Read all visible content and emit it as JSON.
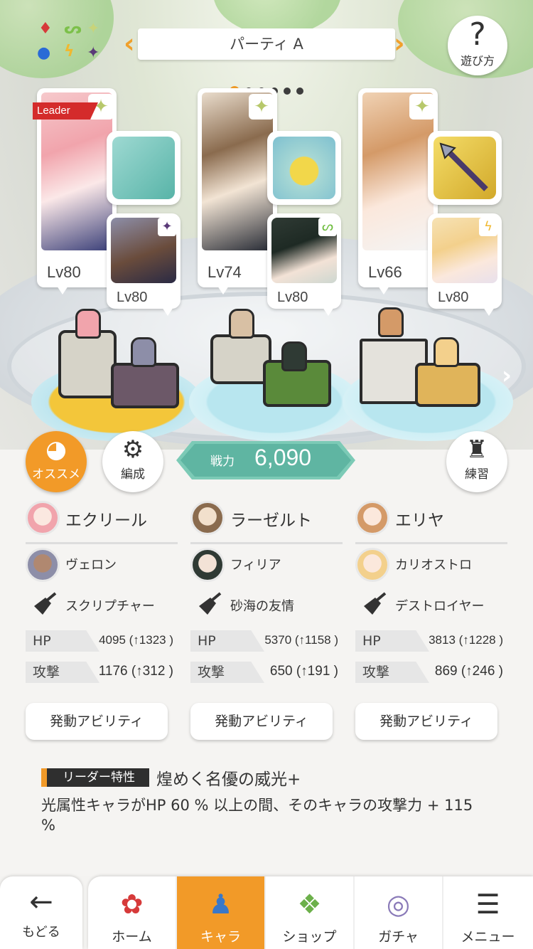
{
  "party": {
    "title": "パーティ A",
    "page_count": 6,
    "current_page": 1,
    "help_label": "遊び方"
  },
  "leader_badge": "Leader",
  "slots": [
    {
      "main": {
        "name": "エクリール",
        "level": "Lv80",
        "element": "light",
        "hair": "#f1a4ac"
      },
      "equipment": {
        "name": "スクリプチャー",
        "icon": "book-icon",
        "bg": "#7cc6c2"
      },
      "sub": {
        "name": "ヴェロン",
        "level": "Lv80",
        "element": "dark",
        "element_icon": "✦"
      },
      "stats": {
        "hp_label": "HP",
        "hp": "4095 (↑1323 )",
        "atk_label": "攻撃",
        "atk": "1176 (↑312 )"
      },
      "ability_label": "発動アビリティ",
      "pedestal_color": "#f3c63a",
      "block_color": "#6c5868"
    },
    {
      "main": {
        "name": "ラーゼルト",
        "level": "Lv74",
        "element": "light",
        "hair": "#8a6b4e"
      },
      "equipment": {
        "name": "砂海の友情",
        "icon": "coin-icon",
        "bg": "#a8d8d4"
      },
      "sub": {
        "name": "フィリア",
        "level": "Lv80",
        "element": "wind",
        "element_icon": "ᔕ"
      },
      "stats": {
        "hp_label": "HP",
        "hp": "5370 (↑1158 )",
        "atk_label": "攻撃",
        "atk": "650 (↑191 )"
      },
      "ability_label": "発動アビリティ",
      "pedestal_color": "#b8e6ef",
      "block_color": "#5a8a3a"
    },
    {
      "main": {
        "name": "エリヤ",
        "level": "Lv66",
        "element": "light",
        "hair": "#d49a68"
      },
      "equipment": {
        "name": "デストロイヤー",
        "icon": "spear-icon",
        "bg": "#e6c640"
      },
      "sub": {
        "name": "カリオストロ",
        "level": "Lv80",
        "element": "thunder",
        "element_icon": "ϟ"
      },
      "stats": {
        "hp_label": "HP",
        "hp": "3813 (↑1228 )",
        "atk_label": "攻撃",
        "atk": "869 (↑246 )"
      },
      "ability_label": "発動アビリティ",
      "pedestal_color": "#b8e6ef",
      "block_color": "#e0b45a"
    }
  ],
  "buttons": {
    "recommend": "オススメ",
    "edit": "編成",
    "practice": "練習"
  },
  "power": {
    "label": "戦力",
    "value": "6,090"
  },
  "leader_trait": {
    "tag": "リーダー特性",
    "name": "煌めく名優の威光+",
    "description": "光属性キャラがHP 60 % 以上の間、そのキャラの攻撃力 + 115 %"
  },
  "nav": {
    "back": "もどる",
    "tabs": [
      "ホーム",
      "キャラ",
      "ショップ",
      "ガチャ",
      "メニュー"
    ],
    "active_tab": "キャラ"
  },
  "colors": {
    "accent": "#f29a28",
    "power": "#5fb5a2",
    "leader": "#d42b2b",
    "element_light": "#b7c86b"
  }
}
